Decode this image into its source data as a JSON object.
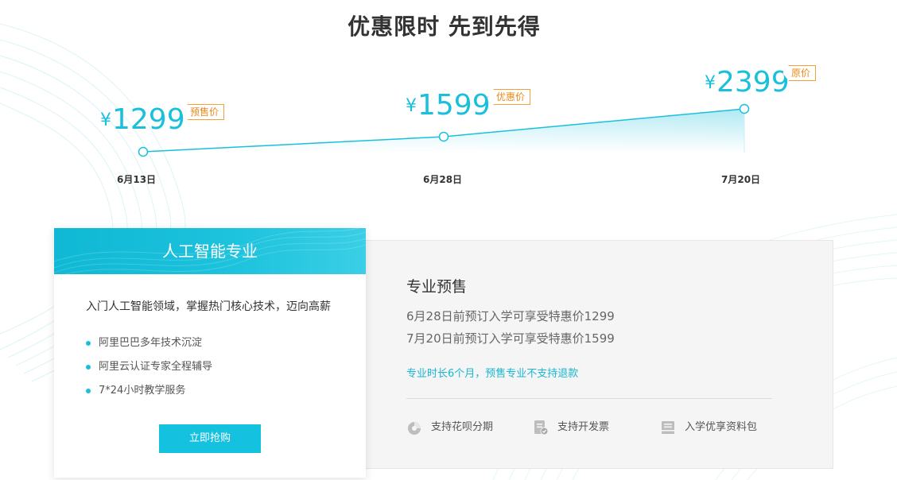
{
  "page": {
    "title": "优惠限时 先到先得"
  },
  "timeline": {
    "currency": "¥",
    "points": [
      {
        "price": "1299",
        "tag": "预售价",
        "date": "6月13日"
      },
      {
        "price": "1599",
        "tag": "优惠价",
        "date": "6月28日"
      },
      {
        "price": "2399",
        "tag": "原价",
        "date": "7月20日"
      }
    ],
    "line_color": "#19c0dc",
    "tag_color": "#ea8a1b"
  },
  "course_card": {
    "title": "人工智能专业",
    "description": "入门人工智能领域，掌握热门核心技术，迈向高薪",
    "features": [
      "阿里巴巴多年技术沉淀",
      "阿里云认证专家全程辅导",
      "7*24小时教学服务"
    ],
    "buy_label": "立即抢购",
    "accent_color": "#14c1df"
  },
  "presale": {
    "title": "专业预售",
    "lines": [
      "6月28日前预订入学可享受特惠价1299",
      "7月20日前预订入学可享受特惠价1599"
    ],
    "note": "专业时长6个月，预售专业不支持退款",
    "perks": [
      {
        "icon": "huabei-icon",
        "label": "支持花呗分期"
      },
      {
        "icon": "invoice-icon",
        "label": "支持开发票"
      },
      {
        "icon": "document-pack-icon",
        "label": "入学优享资料包"
      }
    ]
  }
}
